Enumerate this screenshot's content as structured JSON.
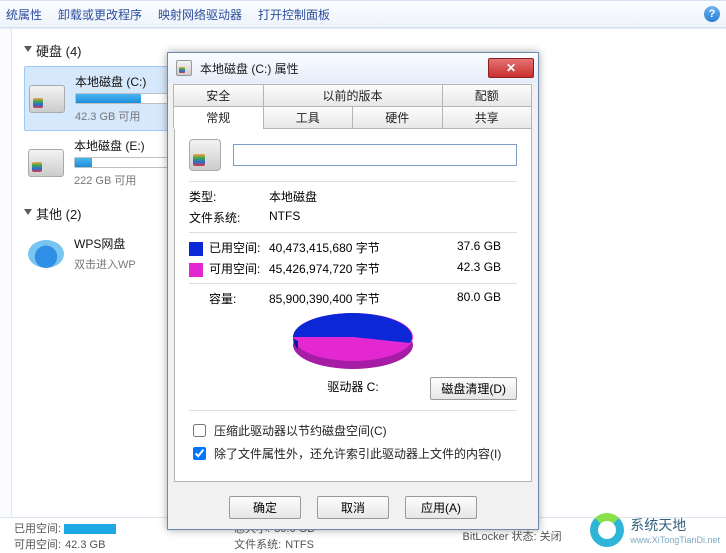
{
  "toolbar": {
    "menu0": "统属性",
    "menu1": "卸载或更改程序",
    "menu2": "映射网络驱动器",
    "menu3": "打开控制面板"
  },
  "sections": {
    "drives_header": "硬盘 (4)",
    "others_header": "其他 (2)"
  },
  "drives": [
    {
      "name": "本地磁盘 (C:)",
      "detail": "42.3 GB 可用"
    },
    {
      "name": "本地磁盘 (E:)",
      "detail": "222 GB 可用"
    }
  ],
  "others": [
    {
      "name": "WPS网盘",
      "detail": "双击进入WP"
    }
  ],
  "dialog": {
    "title": "本地磁盘 (C:) 属性",
    "tabs_row1": [
      "安全",
      "以前的版本",
      "配额"
    ],
    "tabs_row2": [
      "常规",
      "工具",
      "硬件",
      "共享"
    ],
    "name_value": "",
    "type_label": "类型:",
    "type_value": "本地磁盘",
    "fs_label": "文件系统:",
    "fs_value": "NTFS",
    "used_label": "已用空间:",
    "used_bytes": "40,473,415,680 字节",
    "used_gb": "37.6 GB",
    "free_label": "可用空间:",
    "free_bytes": "45,426,974,720 字节",
    "free_gb": "42.3 GB",
    "cap_label": "容量:",
    "cap_bytes": "85,900,390,400 字节",
    "cap_gb": "80.0 GB",
    "drive_caption": "驱动器 C:",
    "cleanup_btn": "磁盘清理(D)",
    "chk_compress": "压缩此驱动器以节约磁盘空间(C)",
    "chk_index": "除了文件属性外，还允许索引此驱动器上文件的内容(I)",
    "btn_ok": "确定",
    "btn_cancel": "取消",
    "btn_apply": "应用(A)",
    "colors": {
      "used": "#0b27d6",
      "free": "#e328d2"
    }
  },
  "status": {
    "used_label": "已用空间:",
    "free_label": "可用空间:",
    "free_value": "42.3 GB",
    "size_label": "总大小:",
    "size_value": "80.0 GB",
    "fs_label": "文件系统:",
    "fs_value": "NTFS",
    "bitlocker": "BitLocker 状态: 关闭"
  },
  "watermark": {
    "title": "系统天地",
    "url": "www.XiTongTianDi.net"
  },
  "chart_data": {
    "type": "pie",
    "title": "驱动器 C:",
    "series": [
      {
        "name": "已用空间",
        "value": 37.6,
        "unit": "GB",
        "color": "#0b27d6"
      },
      {
        "name": "可用空间",
        "value": 42.3,
        "unit": "GB",
        "color": "#e328d2"
      }
    ],
    "total": {
      "name": "容量",
      "value": 80.0,
      "unit": "GB"
    }
  }
}
